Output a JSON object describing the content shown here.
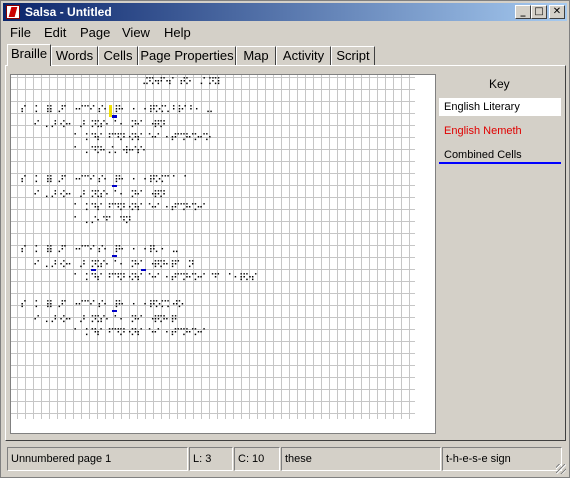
{
  "window": {
    "title": "Salsa - Untitled"
  },
  "title_buttons": {
    "minimize": "_",
    "maximize": "□",
    "close": "✕"
  },
  "menu": [
    "File",
    "Edit",
    "Page",
    "View",
    "Help"
  ],
  "tabs": [
    "Braille",
    "Words",
    "Cells",
    "Page Properties",
    "Map",
    "Activity",
    "Script"
  ],
  "active_tab": "Braille",
  "braille_lines": {
    "header": "⠠⠝⠕⠞⠑⠎⠀⠞⠕⠀⠠⠁⠝⠽",
    "p1_l1": "⠰⠁⠀⠅⠀⠿⠀⠜⠁⠀⠒⠉⠑⠁⠎⠂⠀⠟⠂⠀⠂⠀⠂⠟⠕⠍⠄⠃⠗⠁⠃⠂⠀⠤",
    "p1_l2": "⠊⠀⠄⠜⠐⠕⠂⠀⠜⠀⠝⠵⠑⠀⠁⠂⠀⠝⠊⠀⠐⠟⠝",
    "p1_l3": "⠁⠀⠅⠙⠎⠀⠋⠙⠝⠐⠝⠎⠀⠑⠊⠀⠂⠞⠉⠝⠊⠕⠊⠕",
    "p1_l4": "⠁⠀⠄⠙⠝⠂⠌⠄⠐⠗⠊⠎⠂",
    "p2_l1": "⠰⠁⠀⠅⠀⠿⠀⠜⠁⠀⠒⠉⠑⠁⠎⠂⠀⠟⠂⠀⠂⠀⠂⠟⠕⠍⠁⠁⠀⠁",
    "p2_l2": "⠊⠀⠄⠜⠐⠕⠂⠀⠜⠀⠝⠵⠑⠀⠁⠂⠀⠝⠊⠀⠐⠟⠝",
    "p2_l3": "⠁⠀⠅⠙⠎⠀⠋⠙⠝⠐⠝⠎⠀⠑⠊⠀⠂⠞⠉⠝⠊⠕⠊",
    "p2_l4": "⠁⠀⠄⠌⠂⠙⠁⠀⠙⠝",
    "p3_l1": "⠰⠁⠀⠅⠀⠿⠀⠜⠁⠀⠒⠉⠑⠁⠎⠂⠀⠟⠂⠀⠂⠀⠂⠟⠄⠂⠀⠤",
    "p3_l2": "⠊⠀⠄⠜⠐⠕⠂⠀⠜⠀⠝⠵⠑⠀⠁⠂⠀⠝⠊⠀⠐⠟⠝⠂⠟⠁⠀⠝",
    "p3_l3": "⠁⠀⠅⠙⠎⠀⠋⠙⠝⠐⠝⠎⠀⠑⠊⠀⠂⠞⠉⠝⠊⠕⠊⠀⠙⠁⠀⠁⠂⠟⠕⠎",
    "p4_l1": "⠰⠁⠀⠅⠀⠿⠀⠜⠁⠀⠒⠉⠑⠁⠎⠂⠀⠟⠂⠀⠂⠀⠂⠟⠕⠍⠅⠚⠕",
    "p4_l2": "⠊⠀⠄⠜⠐⠕⠂⠀⠜⠀⠝⠵⠑⠀⠁⠂⠀⠝⠊⠀⠐⠟⠝⠂⠟",
    "p4_l3": "⠁⠀⠅⠙⠎⠀⠋⠙⠝⠐⠝⠎⠀⠑⠊⠀⠂⠞⠉⠝⠊⠕⠊"
  },
  "key": {
    "title": "Key",
    "items": [
      "English Literary",
      "English Nemeth",
      "Combined Cells"
    ],
    "colors": {
      "nemeth": "#e00000",
      "combined": "#0000ff",
      "cursor": "#f0e000"
    }
  },
  "status": {
    "page": "Unnumbered page 1",
    "line": "L: 3",
    "column": "C: 10",
    "word": "these",
    "sign": "t-h-e-s-e sign"
  }
}
